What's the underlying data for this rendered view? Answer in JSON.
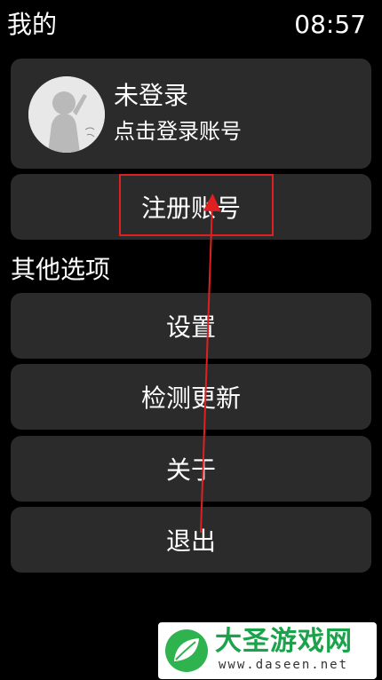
{
  "header": {
    "title": "我的",
    "time": "08:57"
  },
  "profile": {
    "name": "未登录",
    "subtitle": "点击登录账号",
    "avatar_icon": "user-avatar-icon"
  },
  "register": {
    "label": "注册账号"
  },
  "section": {
    "label": "其他选项"
  },
  "options": [
    {
      "label": "设置"
    },
    {
      "label": "检测更新"
    },
    {
      "label": "关于"
    },
    {
      "label": "退出"
    }
  ],
  "annotation": {
    "color": "#e02020"
  },
  "watermark": {
    "title": "大圣游戏网",
    "url": "www.daseen.net",
    "logo_icon": "leaf-logo-icon"
  }
}
